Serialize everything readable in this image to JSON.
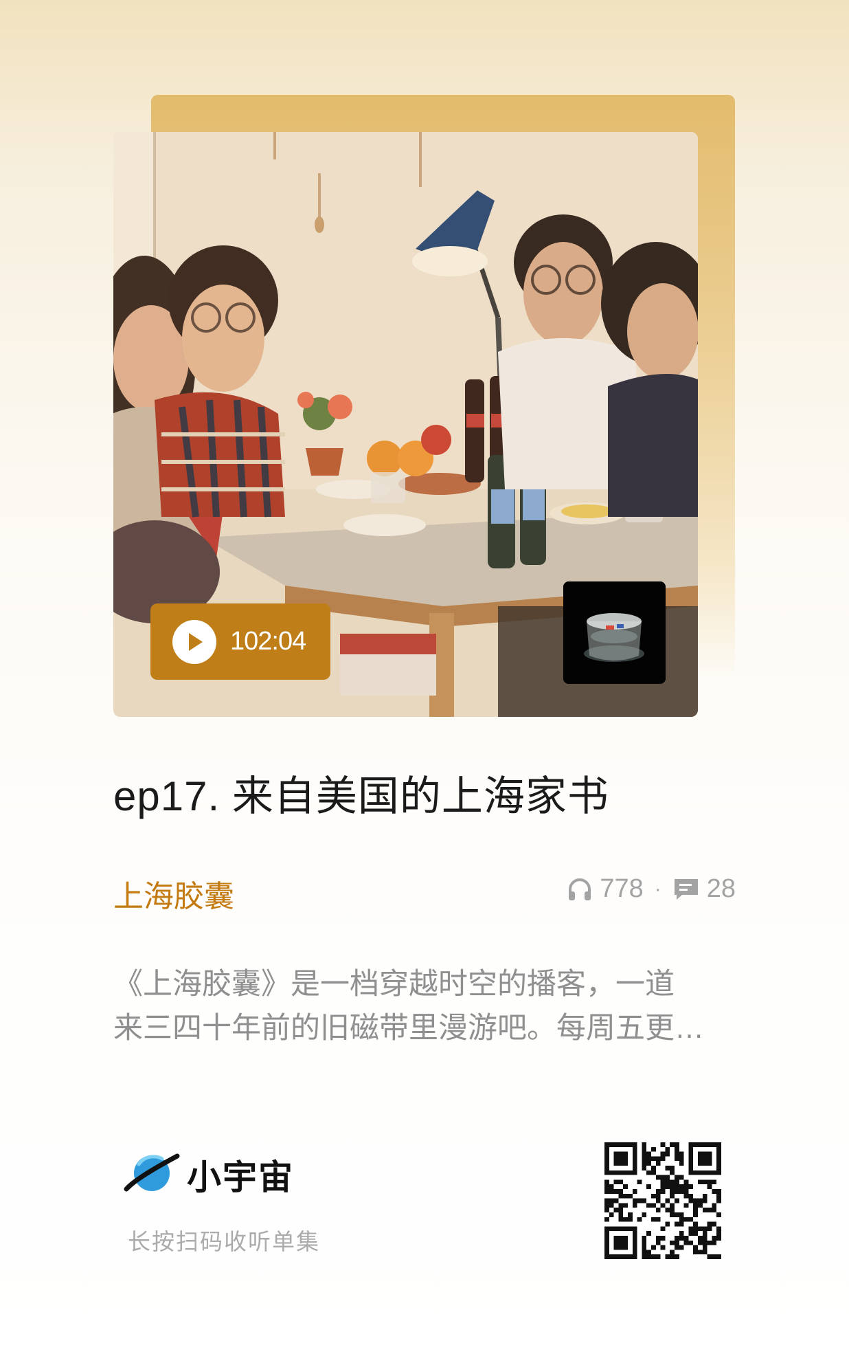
{
  "episode": {
    "duration": "102:04",
    "title": "ep17. 来自美国的上海家书"
  },
  "podcast": {
    "name": "上海胶囊"
  },
  "stats": {
    "plays": "778",
    "separator": "·",
    "comments": "28"
  },
  "description": {
    "line1": "《上海胶囊》是一档穿越时空的播客，一道",
    "line2": "来三四十年前的旧磁带里漫游吧。每周五更…"
  },
  "footer": {
    "brand": "小宇宙",
    "hint": "长按扫码收听单集"
  },
  "colors": {
    "accent": "#bf7e17",
    "podcast_name": "#c27a11",
    "title": "#1b1b1b",
    "secondary_text": "#8f8f8f",
    "brand_planet": "#2f9bdc"
  },
  "icons": {
    "play": "play-icon",
    "headphones": "headphones-icon",
    "comment": "comment-icon",
    "logo": "planet-logo-icon",
    "qr": "qr-code"
  }
}
